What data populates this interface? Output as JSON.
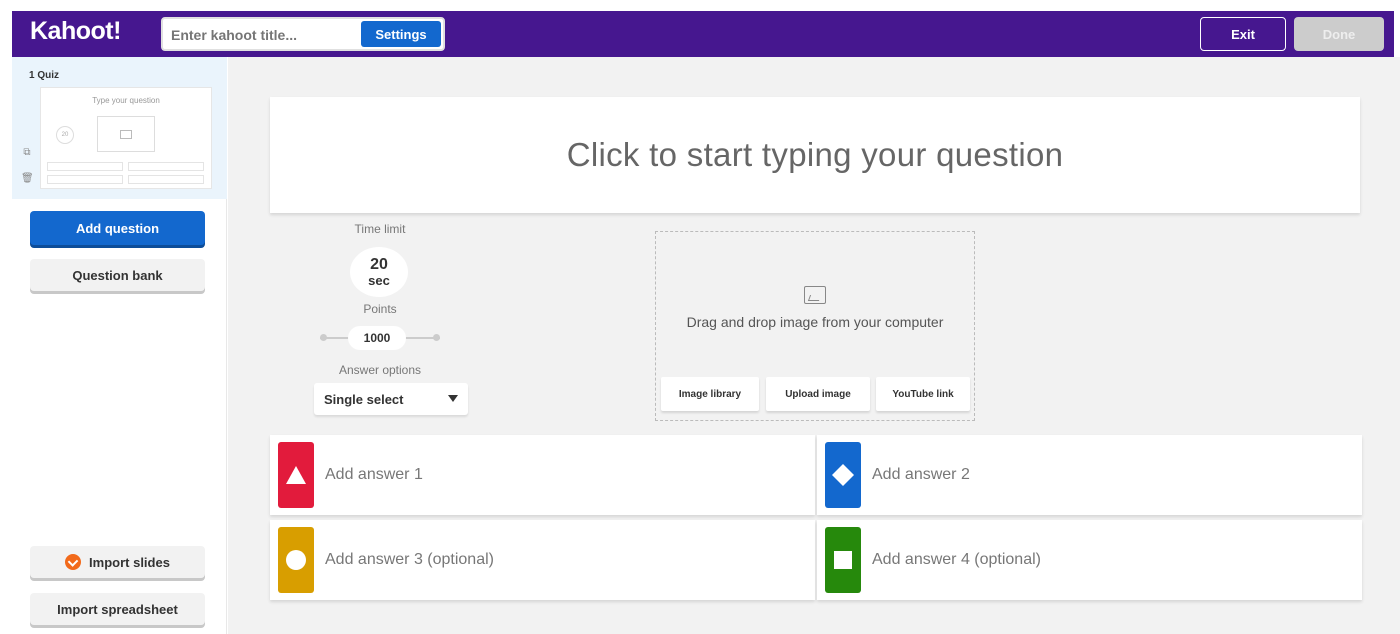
{
  "header": {
    "logo": "Kahoot!",
    "title_placeholder": "Enter kahoot title...",
    "settings_label": "Settings",
    "exit_label": "Exit",
    "done_label": "Done"
  },
  "sidebar": {
    "slide_label": "1  Quiz",
    "thumb_question": "Type your question",
    "thumb_timer": "20",
    "add_question": "Add question",
    "question_bank": "Question bank",
    "import_slides": "Import slides",
    "import_spreadsheet": "Import spreadsheet"
  },
  "editor": {
    "question_placeholder": "Click to start typing your question",
    "time_limit_label": "Time limit",
    "time_value": "20",
    "time_unit": "sec",
    "points_label": "Points",
    "points_value": "1000",
    "answer_options_label": "Answer options",
    "answer_option_selected": "Single select"
  },
  "media": {
    "drop_text": "Drag and drop image from your computer",
    "buttons": [
      "Image library",
      "Upload image",
      "YouTube link"
    ]
  },
  "answers": [
    {
      "label": "Add answer 1",
      "color": "#e21b3c",
      "shape": "triangle-icon"
    },
    {
      "label": "Add answer 2",
      "color": "#1368ce",
      "shape": "diamond-icon"
    },
    {
      "label": "Add answer 3 (optional)",
      "color": "#d89e00",
      "shape": "circle-icon"
    },
    {
      "label": "Add answer 4 (optional)",
      "color": "#26890c",
      "shape": "square-icon"
    }
  ],
  "colors": {
    "header": "#46178f",
    "primary": "#1368ce"
  }
}
